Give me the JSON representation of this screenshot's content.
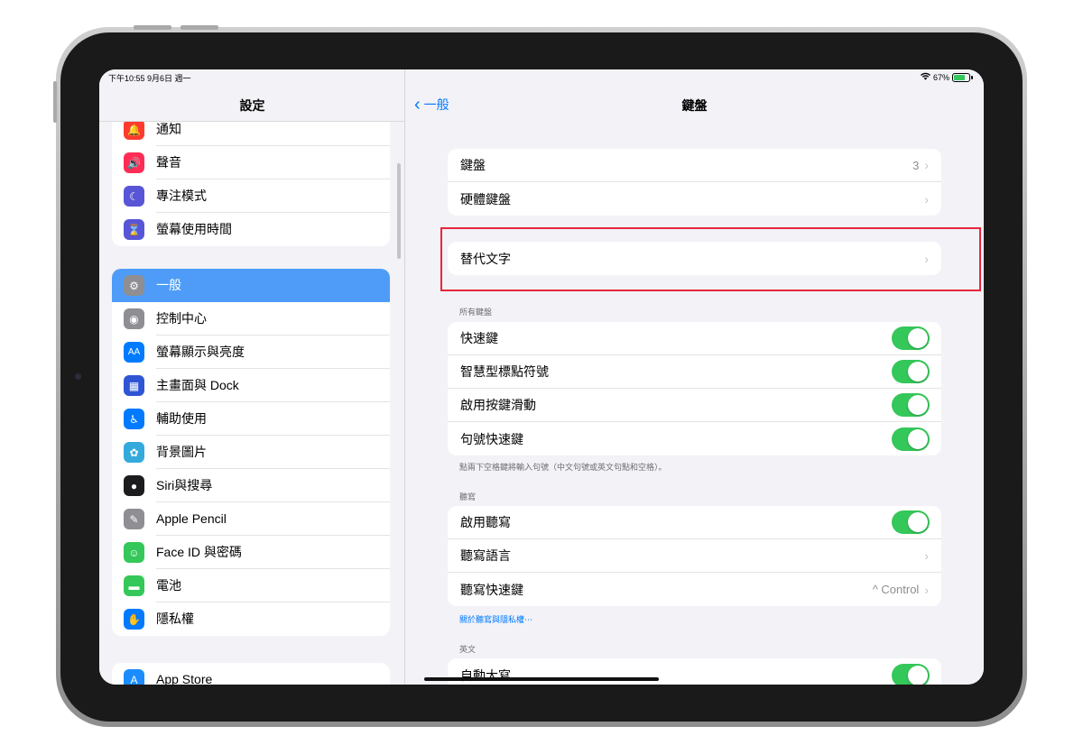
{
  "status_bar": {
    "time": "下午10:55  9月6日 週一",
    "wifi_icon": "wifi-icon",
    "battery": "67%"
  },
  "sidebar": {
    "title": "設定",
    "group1": [
      {
        "label": "通知",
        "icon": "bell-icon",
        "color": "#ff3b30"
      },
      {
        "label": "聲音",
        "icon": "speaker-icon",
        "color": "#ff2d55"
      },
      {
        "label": "專注模式",
        "icon": "moon-icon",
        "color": "#5856d6"
      },
      {
        "label": "螢幕使用時間",
        "icon": "hourglass-icon",
        "color": "#5856d6"
      }
    ],
    "group2": [
      {
        "label": "一般",
        "icon": "gear-icon",
        "color": "#8e8e93",
        "selected": true
      },
      {
        "label": "控制中心",
        "icon": "toggles-icon",
        "color": "#8e8e93"
      },
      {
        "label": "螢幕顯示與亮度",
        "icon": "text-size-icon",
        "color": "#007aff"
      },
      {
        "label": "主畫面與 Dock",
        "icon": "grid-icon",
        "color": "#2f55d4"
      },
      {
        "label": "輔助使用",
        "icon": "accessibility-icon",
        "color": "#007aff"
      },
      {
        "label": "背景圖片",
        "icon": "flower-icon",
        "color": "#34aadc"
      },
      {
        "label": "Siri與搜尋",
        "icon": "siri-icon",
        "color": "#1c1c1e"
      },
      {
        "label": "Apple Pencil",
        "icon": "pencil-icon",
        "color": "#8e8e93"
      },
      {
        "label": "Face ID 與密碼",
        "icon": "faceid-icon",
        "color": "#34c759"
      },
      {
        "label": "電池",
        "icon": "battery-icon",
        "color": "#34c759"
      },
      {
        "label": "隱私權",
        "icon": "hand-icon",
        "color": "#007aff"
      }
    ],
    "group3": [
      {
        "label": "App Store",
        "icon": "appstore-icon",
        "color": "#1a8cff"
      }
    ]
  },
  "detail": {
    "back_label": "一般",
    "title": "鍵盤",
    "keyboards": [
      {
        "label": "鍵盤",
        "value": "3"
      },
      {
        "label": "硬體鍵盤",
        "value": ""
      }
    ],
    "text_replacement": "替代文字",
    "all_keyboards_header": "所有鍵盤",
    "all_keyboards": [
      {
        "label": "快速鍵",
        "on": true
      },
      {
        "label": "智慧型標點符號",
        "on": true
      },
      {
        "label": "啟用按鍵滑動",
        "on": true
      },
      {
        "label": "句號快速鍵",
        "on": true
      }
    ],
    "period_note": "點兩下空格鍵將輸入句號（中文句號或英文句點和空格）。",
    "dictation_header": "聽寫",
    "dictation_enable": "啟用聽寫",
    "dictation_language": "聽寫語言",
    "dictation_shortcut": "聽寫快速鍵",
    "dictation_shortcut_value": "^ Control",
    "dictation_privacy_link": "關於聽寫與隱私權⋯",
    "english_header": "英文",
    "auto_capitalization": "自動大寫"
  }
}
